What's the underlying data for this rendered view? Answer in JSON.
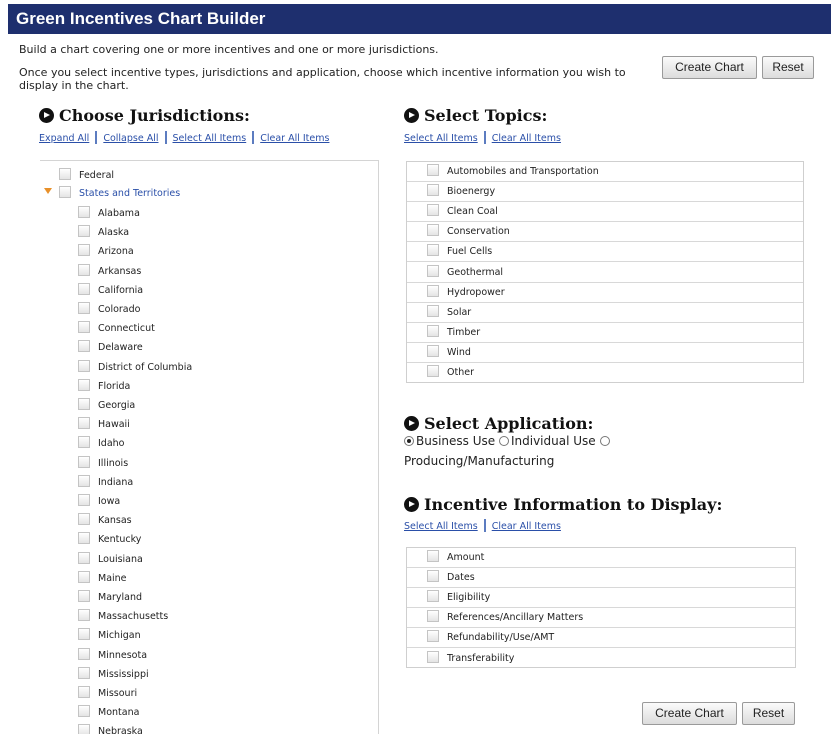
{
  "title": "Green Incentives Chart Builder",
  "intro": {
    "line1": "Build a chart covering one or more incentives and one or more jurisdictions.",
    "line2": "Once you select incentive types, jurisdictions and application, choose which incentive information you wish to display in the chart."
  },
  "buttons": {
    "create_chart": "Create Chart",
    "reset": "Reset"
  },
  "jurisdictions": {
    "heading": "Choose Jurisdictions:",
    "links": {
      "expand_all": "Expand All",
      "collapse_all": "Collapse All",
      "select_all": "Select All Items",
      "clear_all": "Clear All Items"
    },
    "federal": "Federal",
    "group": "States and Territories",
    "states": [
      "Alabama",
      "Alaska",
      "Arizona",
      "Arkansas",
      "California",
      "Colorado",
      "Connecticut",
      "Delaware",
      "District of Columbia",
      "Florida",
      "Georgia",
      "Hawaii",
      "Idaho",
      "Illinois",
      "Indiana",
      "Iowa",
      "Kansas",
      "Kentucky",
      "Louisiana",
      "Maine",
      "Maryland",
      "Massachusetts",
      "Michigan",
      "Minnesota",
      "Mississippi",
      "Missouri",
      "Montana",
      "Nebraska"
    ]
  },
  "topics": {
    "heading": "Select Topics:",
    "links": {
      "select_all": "Select All Items",
      "clear_all": "Clear All Items"
    },
    "items": [
      "Automobiles and Transportation",
      "Bioenergy",
      "Clean Coal",
      "Conservation",
      "Fuel Cells",
      "Geothermal",
      "Hydropower",
      "Solar",
      "Timber",
      "Wind",
      "Other"
    ]
  },
  "application": {
    "heading": "Select Application:",
    "options": [
      "Business Use",
      "Individual Use",
      "Producing/Manufacturing"
    ],
    "selected": "Business Use"
  },
  "display_info": {
    "heading": "Incentive Information to Display:",
    "links": {
      "select_all": "Select All Items",
      "clear_all": "Clear All Items"
    },
    "items": [
      "Amount",
      "Dates",
      "Eligibility",
      "References/Ancillary Matters",
      "Refundability/Use/AMT",
      "Transferability"
    ]
  },
  "colors": {
    "title_bar": "#1e2f6e",
    "link": "#2a4fa8",
    "expand_arrow": "#e8902a"
  }
}
